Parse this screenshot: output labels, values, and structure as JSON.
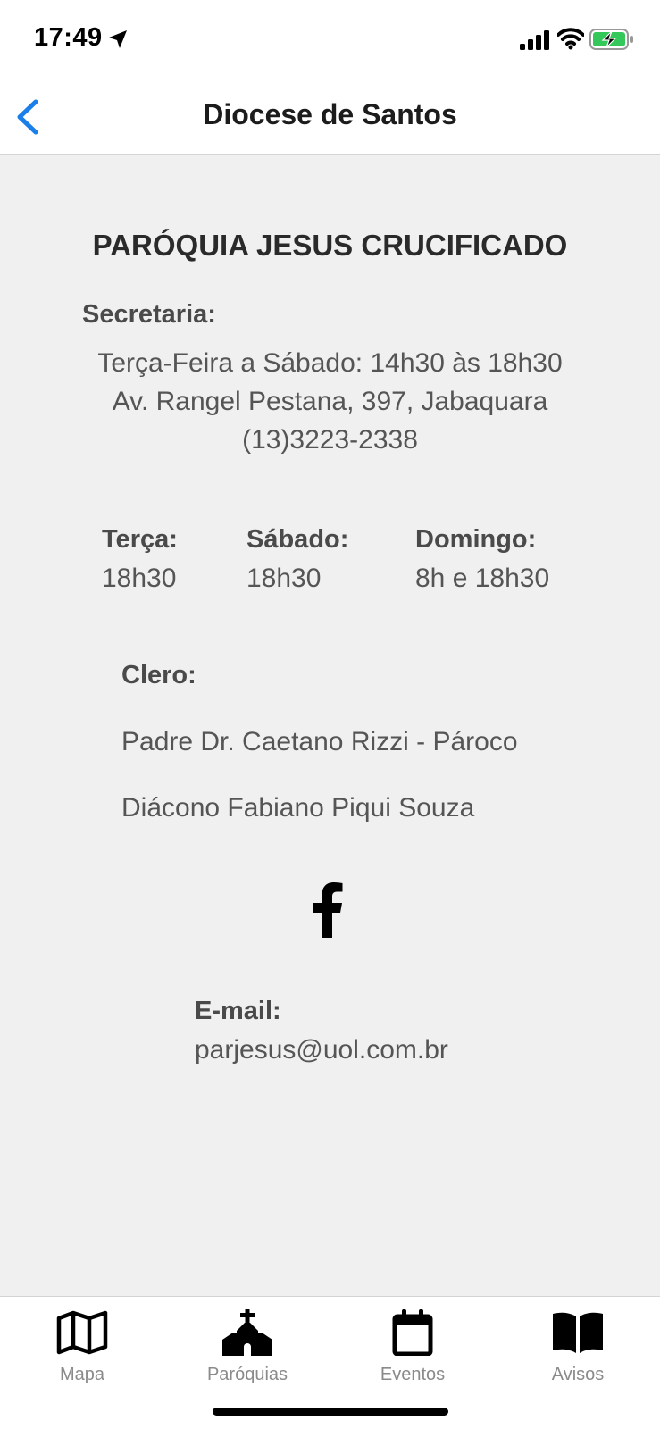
{
  "status_bar": {
    "time": "17:49",
    "icons": [
      "location-arrow-icon",
      "cellular-signal-icon",
      "wifi-icon",
      "battery-charging-icon"
    ],
    "battery_color": "#34c759"
  },
  "nav": {
    "title": "Diocese de Santos",
    "back_icon": "chevron-left-icon",
    "accent_color": "#1a7fe8"
  },
  "parish": {
    "name": "PARÓQUIA JESUS CRUCIFICADO",
    "secretaria_label": "Secretaria:",
    "secretaria_lines": [
      "Terça-Feira a Sábado: 14h30 às 18h30",
      "Av. Rangel Pestana, 397, Jabaquara",
      "(13)3223-2338"
    ],
    "masses": [
      {
        "day": "Terça:",
        "time": "18h30"
      },
      {
        "day": "Sábado:",
        "time": "18h30"
      },
      {
        "day": "Domingo:",
        "time": "8h e 18h30"
      }
    ],
    "clero_label": "Clero:",
    "clero": [
      "Padre Dr. Caetano Rizzi - Pároco",
      "Diácono Fabiano Piqui Souza"
    ],
    "social_icon": "facebook-icon",
    "email_label": "E-mail:",
    "email": "parjesus@uol.com.br"
  },
  "tabs": [
    {
      "label": "Mapa",
      "icon": "map-icon"
    },
    {
      "label": "Paróquias",
      "icon": "church-icon"
    },
    {
      "label": "Eventos",
      "icon": "calendar-icon"
    },
    {
      "label": "Avisos",
      "icon": "book-icon"
    }
  ]
}
